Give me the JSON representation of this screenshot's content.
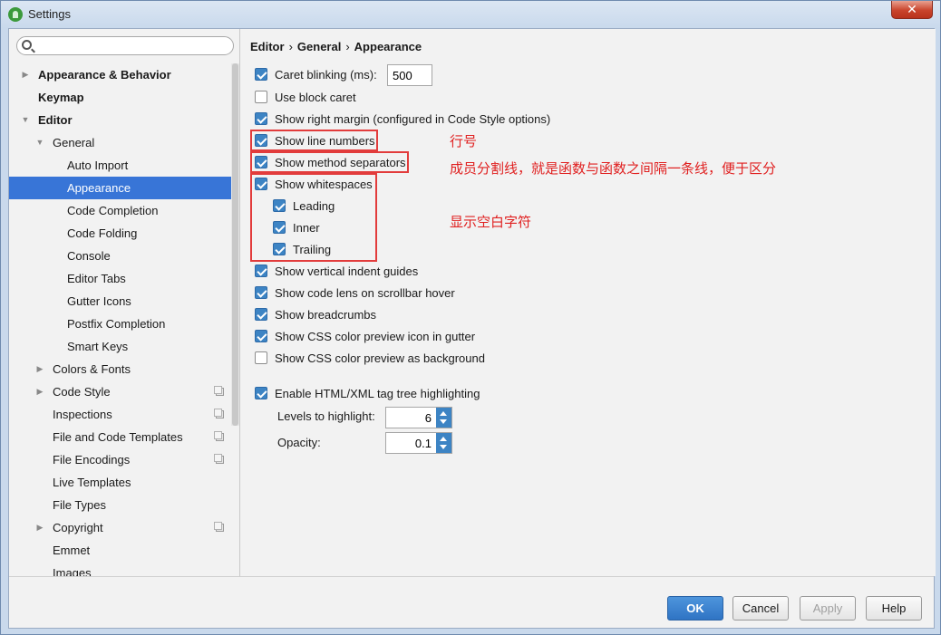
{
  "window": {
    "title": "Settings",
    "close_glyph": "✕"
  },
  "search": {
    "placeholder": "",
    "value": ""
  },
  "sidebar": {
    "items": [
      {
        "label": "Appearance & Behavior",
        "level": 0,
        "bold": true,
        "arrow": "▶"
      },
      {
        "label": "Keymap",
        "level": 0,
        "bold": true,
        "arrow": ""
      },
      {
        "label": "Editor",
        "level": 0,
        "bold": true,
        "arrow": "▼"
      },
      {
        "label": "General",
        "level": 1,
        "bold": false,
        "arrow": "▼"
      },
      {
        "label": "Auto Import",
        "level": 2,
        "bold": false,
        "arrow": ""
      },
      {
        "label": "Appearance",
        "level": 2,
        "bold": false,
        "arrow": "",
        "selected": true
      },
      {
        "label": "Code Completion",
        "level": 2,
        "bold": false,
        "arrow": ""
      },
      {
        "label": "Code Folding",
        "level": 2,
        "bold": false,
        "arrow": ""
      },
      {
        "label": "Console",
        "level": 2,
        "bold": false,
        "arrow": ""
      },
      {
        "label": "Editor Tabs",
        "level": 2,
        "bold": false,
        "arrow": ""
      },
      {
        "label": "Gutter Icons",
        "level": 2,
        "bold": false,
        "arrow": ""
      },
      {
        "label": "Postfix Completion",
        "level": 2,
        "bold": false,
        "arrow": ""
      },
      {
        "label": "Smart Keys",
        "level": 2,
        "bold": false,
        "arrow": ""
      },
      {
        "label": "Colors & Fonts",
        "level": 1,
        "bold": false,
        "arrow": "▶"
      },
      {
        "label": "Code Style",
        "level": 1,
        "bold": false,
        "arrow": "▶",
        "copy": true
      },
      {
        "label": "Inspections",
        "level": 1,
        "bold": false,
        "arrow": "",
        "copy": true
      },
      {
        "label": "File and Code Templates",
        "level": 1,
        "bold": false,
        "arrow": "",
        "copy": true
      },
      {
        "label": "File Encodings",
        "level": 1,
        "bold": false,
        "arrow": "",
        "copy": true
      },
      {
        "label": "Live Templates",
        "level": 1,
        "bold": false,
        "arrow": ""
      },
      {
        "label": "File Types",
        "level": 1,
        "bold": false,
        "arrow": ""
      },
      {
        "label": "Copyright",
        "level": 1,
        "bold": false,
        "arrow": "▶",
        "copy": true
      },
      {
        "label": "Emmet",
        "level": 1,
        "bold": false,
        "arrow": ""
      },
      {
        "label": "Images",
        "level": 1,
        "bold": false,
        "arrow": ""
      }
    ]
  },
  "breadcrumb": {
    "part1": "Editor",
    "part2": "General",
    "part3": "Appearance",
    "sep": "›"
  },
  "options": {
    "caret_blinking": {
      "label": "Caret blinking (ms):",
      "checked": true,
      "value": "500"
    },
    "block_caret": {
      "label": "Use block caret",
      "checked": false
    },
    "right_margin": {
      "label": "Show right margin (configured in Code Style options)",
      "checked": true
    },
    "line_numbers": {
      "label": "Show line numbers",
      "checked": true
    },
    "method_separators": {
      "label": "Show method separators",
      "checked": true
    },
    "whitespaces": {
      "label": "Show whitespaces",
      "checked": true
    },
    "leading": {
      "label": "Leading",
      "checked": true
    },
    "inner": {
      "label": "Inner",
      "checked": true
    },
    "trailing": {
      "label": "Trailing",
      "checked": true
    },
    "indent_guides": {
      "label": "Show vertical indent guides",
      "checked": true
    },
    "code_lens": {
      "label": "Show code lens on scrollbar hover",
      "checked": true
    },
    "breadcrumbs": {
      "label": "Show breadcrumbs",
      "checked": true
    },
    "css_gutter": {
      "label": "Show CSS color preview icon in gutter",
      "checked": true
    },
    "css_background": {
      "label": "Show CSS color preview as background",
      "checked": false
    },
    "tag_tree": {
      "label": "Enable HTML/XML tag tree highlighting",
      "checked": true
    },
    "levels": {
      "label": "Levels to highlight:",
      "value": "6"
    },
    "opacity": {
      "label": "Opacity:",
      "value": "0.1"
    }
  },
  "annotations": {
    "line_numbers": "行号",
    "method_separators": "成员分割线，就是函数与函数之间隔一条线，便于区分",
    "whitespaces": "显示空白字符",
    "color": "#e02020"
  },
  "footer": {
    "ok": "OK",
    "cancel": "Cancel",
    "apply": "Apply",
    "help": "Help"
  },
  "colors": {
    "accent": "#3875d7",
    "checkbox": "#3d84c4",
    "highlight_box": "#e23c3c"
  }
}
